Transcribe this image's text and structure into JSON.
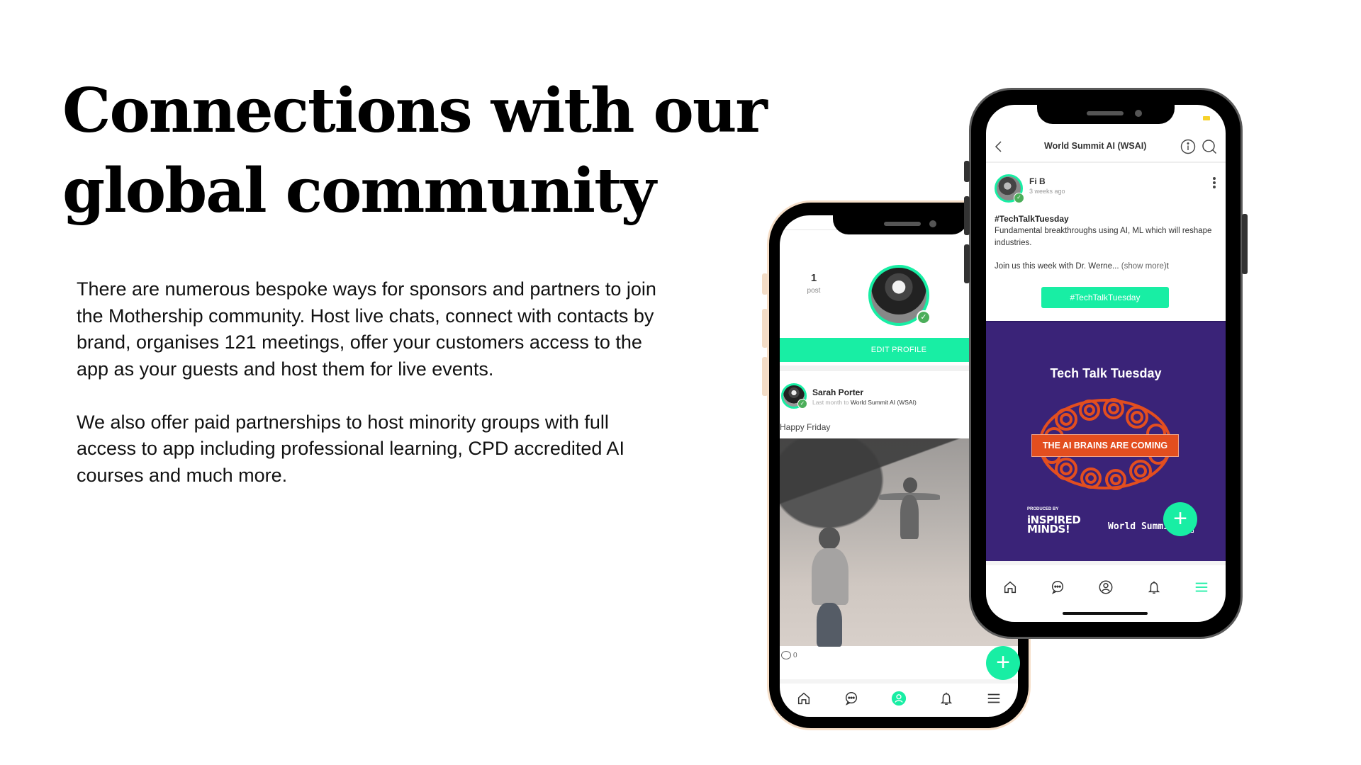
{
  "slide": {
    "title_lines": [
      "Connections with our",
      "global community"
    ],
    "paragraphs": [
      "There are numerous bespoke ways for sponsors and partners to join the Mothership community. Host live chats, connect with contacts by brand, organises 121 meetings, offer your customers access to the app as your guests and host them for live events.",
      "We also offer paid partnerships to host minority groups with full access to app including professional learning, CPD accredited AI courses and much more."
    ]
  },
  "colors": {
    "accent": "#18eea4",
    "banner_purple": "#3a2378",
    "banner_orange": "#e34e1f",
    "verified_green": "#4cae5a"
  },
  "phone_profile": {
    "post_count": "1",
    "post_label": "post",
    "edit_profile_label": "EDIT PROFILE",
    "post": {
      "author": "Sarah Porter",
      "meta_prefix": "Last month to",
      "meta_group": "World Summit AI (WSAI)",
      "text": "Happy Friday",
      "comment_count": "0"
    },
    "fab_label": "+",
    "tabs": [
      {
        "icon": "home-icon",
        "active": false
      },
      {
        "icon": "chat-icon",
        "active": false
      },
      {
        "icon": "profile-icon",
        "active": true
      },
      {
        "icon": "bell-icon",
        "active": false
      },
      {
        "icon": "menu-icon",
        "active": false
      }
    ]
  },
  "phone_group": {
    "title": "World Summit AI (WSAI)",
    "post": {
      "author": "Fi B",
      "time": "3 weeks ago",
      "hashtag": "#TechTalkTuesday",
      "body": "Fundamental breakthroughs using AI, ML which will reshape industries.",
      "join_text": "Join us this week with Dr. Werne...",
      "show_more": "(show more)",
      "trailing": "t",
      "tag_button": "#TechTalkTuesday"
    },
    "banner": {
      "title": "Tech Talk Tuesday",
      "band_text": "THE AI BRAINS ARE COMING",
      "produced_by": "PRODUCED BY",
      "producer_line1": "iNSPIRED",
      "producer_line2": "MINDS!",
      "wsai_text": "World Summit",
      "wsai_box": "AI"
    },
    "fab_label": "+",
    "tabs": [
      {
        "icon": "home-icon",
        "active": false
      },
      {
        "icon": "chat-icon",
        "active": false
      },
      {
        "icon": "profile-icon",
        "active": false
      },
      {
        "icon": "bell-icon",
        "active": false
      },
      {
        "icon": "menu-icon",
        "active": true
      }
    ]
  }
}
